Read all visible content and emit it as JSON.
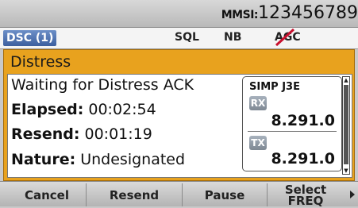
{
  "status": {
    "mmsi_label": "MMSI:",
    "mmsi_value": "123456789"
  },
  "indicators": {
    "dsc": "DSC (1)",
    "sql": "SQL",
    "nb": "NB",
    "agc": "AGC"
  },
  "panel": {
    "title": "Distress",
    "message": "Waiting for Distress ACK",
    "elapsed_label": "Elapsed:",
    "elapsed_value": "00:02:54",
    "resend_label": "Resend:",
    "resend_value": "00:01:19",
    "nature_label": "Nature:",
    "nature_value": "Undesignated"
  },
  "freq": {
    "mode": "SIMP J3E",
    "rx_label": "RX",
    "rx_value": "8.291.0",
    "tx_label": "TX",
    "tx_value": "8.291.0"
  },
  "softkeys": {
    "cancel": "Cancel",
    "resend": "Resend",
    "pause": "Pause",
    "select_line1": "Select",
    "select_line2": "FREQ"
  },
  "colors": {
    "panel_accent": "#e8a21e",
    "dsc_badge": "#4a6db0"
  }
}
